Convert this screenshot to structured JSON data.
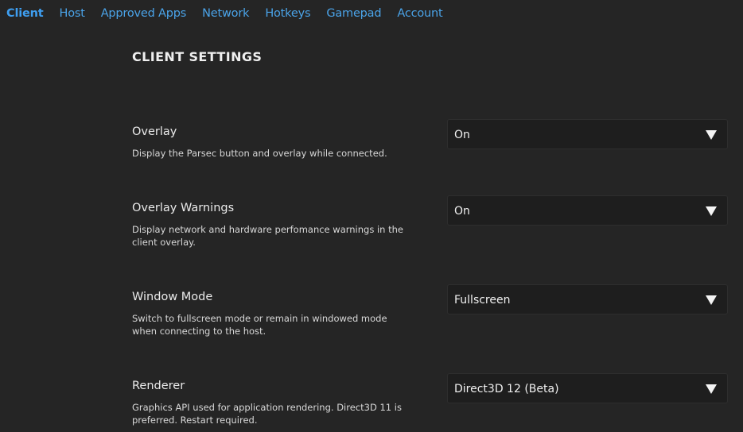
{
  "nav": {
    "tabs": [
      {
        "label": "Client",
        "active": true
      },
      {
        "label": "Host",
        "active": false
      },
      {
        "label": "Approved Apps",
        "active": false
      },
      {
        "label": "Network",
        "active": false
      },
      {
        "label": "Hotkeys",
        "active": false
      },
      {
        "label": "Gamepad",
        "active": false
      },
      {
        "label": "Account",
        "active": false
      }
    ]
  },
  "page": {
    "title": "CLIENT SETTINGS"
  },
  "settings": [
    {
      "label": "Overlay",
      "description": "Display the Parsec button and overlay while connected.",
      "value": "On"
    },
    {
      "label": "Overlay Warnings",
      "description": "Display network and hardware perfomance warnings in the client overlay.",
      "value": "On"
    },
    {
      "label": "Window Mode",
      "description": "Switch to fullscreen mode or remain in windowed mode when connecting to the host.",
      "value": "Fullscreen"
    },
    {
      "label": "Renderer",
      "description": "Graphics API used for application rendering. Direct3D 11 is preferred. Restart required.",
      "value": "Direct3D 12 (Beta)"
    }
  ],
  "colors": {
    "background": "#252525",
    "accent": "#3e9ef0",
    "dropdown_bg": "#1e1e1e"
  }
}
